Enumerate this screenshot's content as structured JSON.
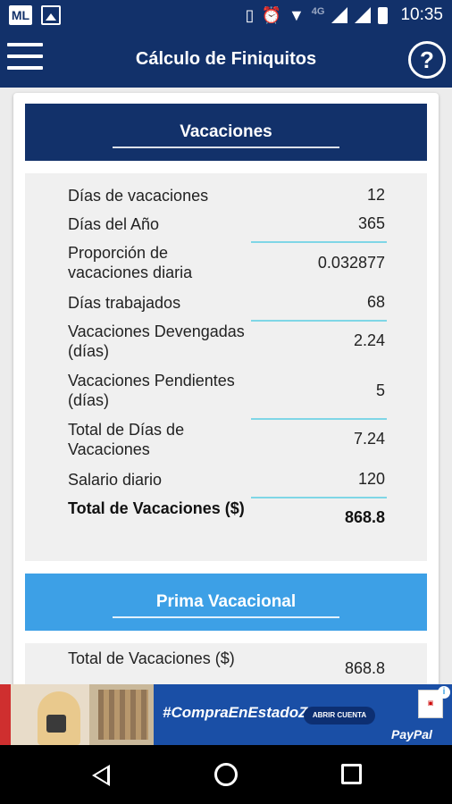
{
  "status_bar": {
    "app_badge": "ML",
    "network": "4G",
    "time": "10:35"
  },
  "app_bar": {
    "title": "Cálculo de Finiquitos",
    "help_symbol": "?"
  },
  "vacaciones": {
    "title": "Vacaciones",
    "rows": [
      {
        "label": "Días de vacaciones",
        "value": "12"
      },
      {
        "label": "Días del Año",
        "value": "365"
      },
      {
        "label": "Proporción de vacaciones diaria",
        "value": "0.032877"
      },
      {
        "label": "Días trabajados",
        "value": "68"
      },
      {
        "label": "Vacaciones Devengadas (días)",
        "value": "2.24"
      },
      {
        "label": "Vacaciones Pendientes (días)",
        "value": "5"
      },
      {
        "label": "Total de Días de Vacaciones",
        "value": "7.24"
      },
      {
        "label": "Salario diario",
        "value": "120"
      },
      {
        "label": "Total de Vacaciones ($)",
        "value": "868.8"
      }
    ]
  },
  "prima_vacacional": {
    "title": "Prima Vacacional",
    "rows": [
      {
        "label": "Total de Vacaciones ($)",
        "value": "868.8"
      }
    ]
  },
  "ad": {
    "hashtag": "#CompraEnEstadoZen",
    "button": "ABRIR CUENTA",
    "brand": "PayPal",
    "info": "i"
  },
  "colors": {
    "primary": "#12316a",
    "secondary_header": "#3da0e6",
    "separator": "#7fd6e6"
  }
}
